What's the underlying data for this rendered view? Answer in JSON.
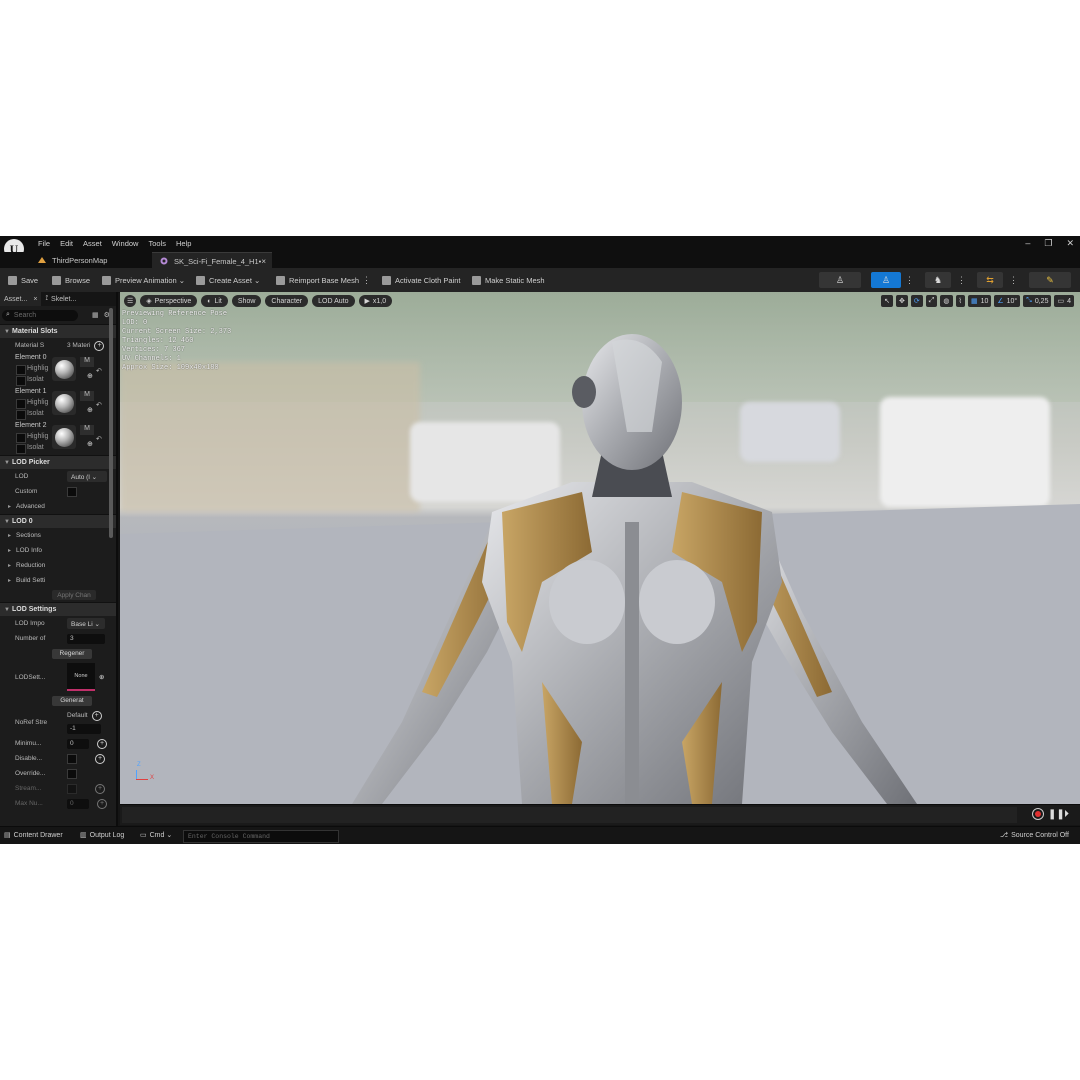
{
  "menu": {
    "items": [
      "File",
      "Edit",
      "Asset",
      "Window",
      "Tools",
      "Help"
    ]
  },
  "window_controls": {
    "minimize": "–",
    "restore": "❐",
    "close": "✕"
  },
  "tabs": [
    {
      "label": "ThirdPersonMap"
    },
    {
      "label": "SK_Sci-Fi_Female_4_H1•",
      "close": "×"
    }
  ],
  "toolbar": {
    "save": "Save",
    "browse": "Browse",
    "preview_animation": "Preview Animation ⌄",
    "create_asset": "Create Asset ⌄",
    "reimport": "Reimport Base Mesh",
    "cloth_paint": "Activate Cloth Paint",
    "static_mesh": "Make Static Mesh"
  },
  "left_panel": {
    "tabs": [
      "Asset...",
      "Skelet..."
    ],
    "search_placeholder": "Search",
    "sections": {
      "material_slots": "Material Slots",
      "lod_picker": "LOD Picker",
      "lod0": "LOD 0",
      "lod_settings": "LOD Settings"
    },
    "material_slots_label": "Material S",
    "material_slots_value": "3 Materi",
    "elements": [
      {
        "label": "Element 0",
        "highlight": "Highlig",
        "isolate": "Isolat",
        "m": "M"
      },
      {
        "label": "Element 1",
        "highlight": "Highlig",
        "isolate": "Isolat",
        "m": "M"
      },
      {
        "label": "Element 2",
        "highlight": "Highlig",
        "isolate": "Isolat",
        "m": "M"
      }
    ],
    "lod_label": "LOD",
    "lod_value": "Auto (l ⌄",
    "custom_label": "Custom",
    "advanced": "Advanced",
    "lod0_items": [
      "Sections",
      "LOD Info",
      "Reduction",
      "Build Setti"
    ],
    "apply_changes": "Apply Chan",
    "lod_import_label": "LOD Impo",
    "lod_import_value": "Base Li ⌄",
    "number_of_label": "Number of",
    "number_of_value": "3",
    "regenerate": "Regener",
    "lod_settings_label": "LODSett...",
    "lod_settings_none": "None",
    "generate": "Generat",
    "default_label": "Default",
    "noref_label": "NoRef Stre",
    "noref_value": "-1",
    "minimum_label": "Minimu...",
    "minimum_value": "0",
    "disable_label": "Disable...",
    "override_label": "Override...",
    "stream_label": "Stream...",
    "maxnum_label": "Max Nu...",
    "maxnum_value": "0"
  },
  "viewport": {
    "pills": [
      "Perspective",
      "Lit",
      "Show",
      "Character",
      "LOD Auto",
      "x1,0"
    ],
    "info": [
      "Previewing Reference Pose",
      "LOD: 0",
      "Current Screen Size: 2,373",
      "Triangles: 12 460",
      "Vertices: 7 367",
      "UV Channels: 1",
      "Approx Size: 109x40x180"
    ],
    "grid_value": "10",
    "angle_value": "10°",
    "scale_value": "0,25",
    "camera_value": "4",
    "axis_z": "Z",
    "axis_x": "X"
  },
  "statusbar": {
    "content_drawer": "Content Drawer",
    "output_log": "Output Log",
    "cmd": "Cmd ⌄",
    "console_placeholder": "Enter Console Command",
    "source_control": "Source Control Off"
  }
}
